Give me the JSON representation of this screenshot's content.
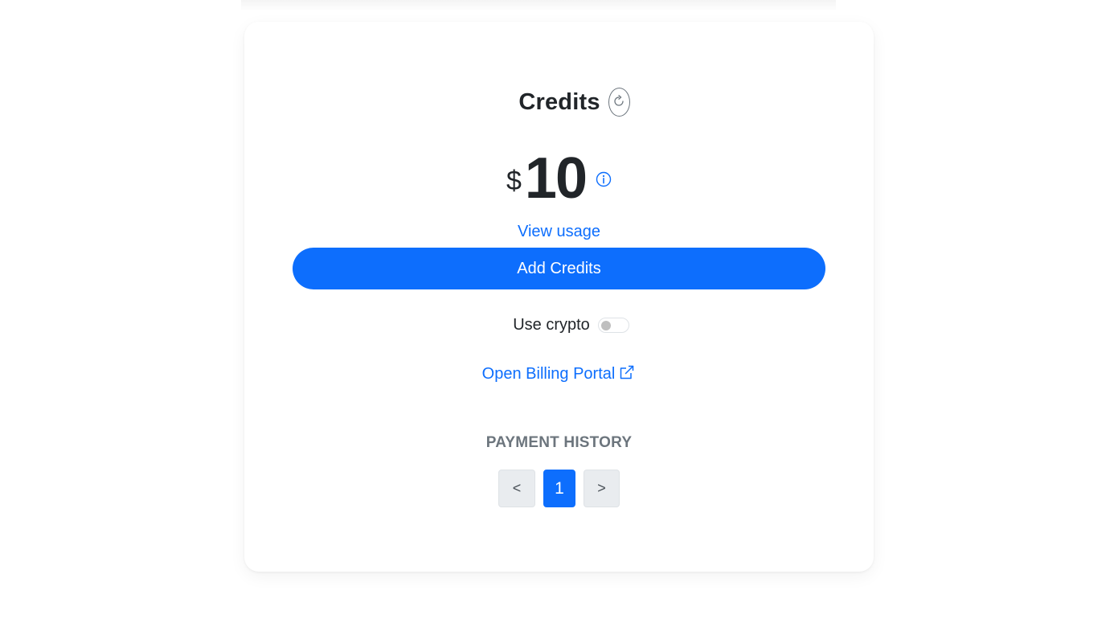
{
  "credits": {
    "title": "Credits",
    "currency_symbol": "$",
    "amount": "10",
    "view_usage_label": "View usage",
    "add_credits_label": "Add Credits"
  },
  "crypto": {
    "label": "Use crypto",
    "enabled": false
  },
  "billing": {
    "portal_label": "Open Billing Portal"
  },
  "payment_history": {
    "heading": "PAYMENT HISTORY",
    "prev_label": "<",
    "current_page": "1",
    "next_label": ">"
  },
  "colors": {
    "accent": "#0d6efd",
    "text": "#212529",
    "muted": "#6c757d"
  },
  "icons": {
    "refresh": "refresh-icon",
    "info": "info-icon",
    "external_link": "external-link-icon"
  }
}
